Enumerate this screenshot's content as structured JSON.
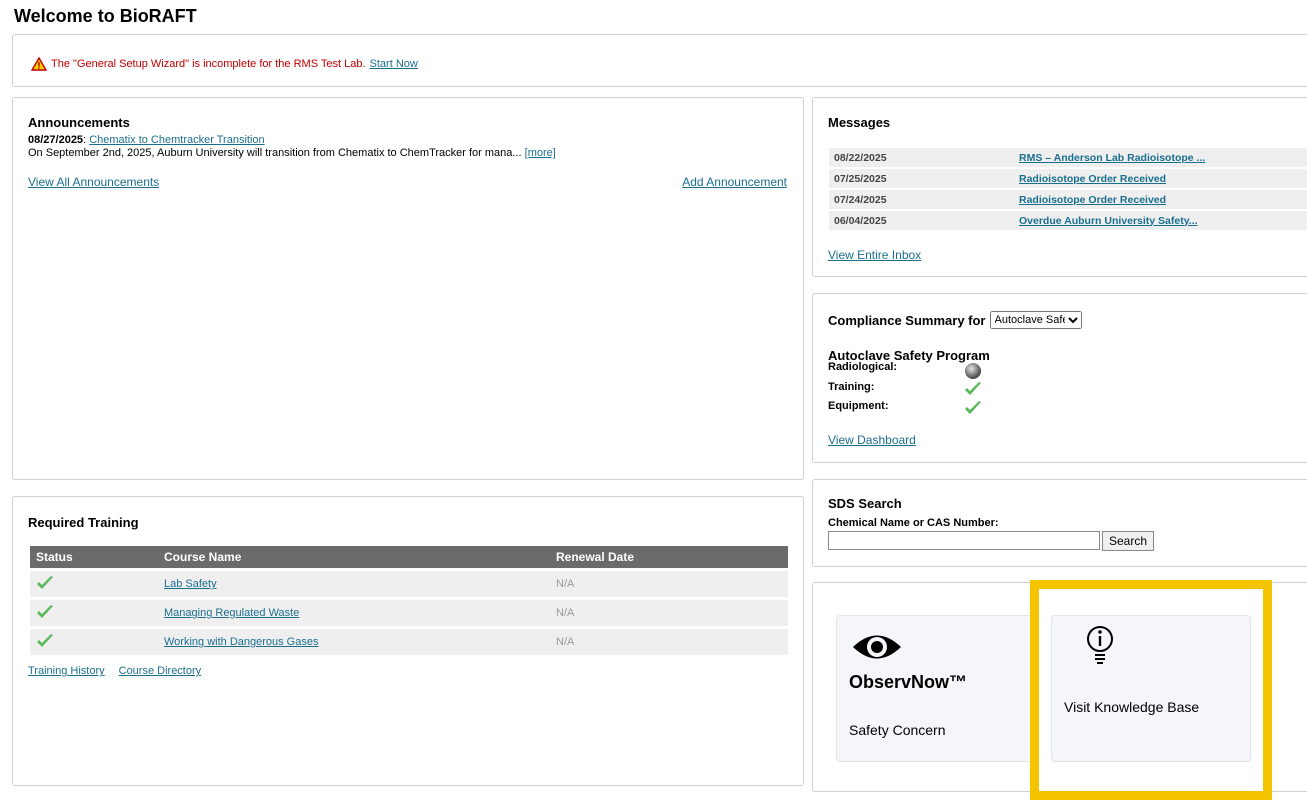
{
  "page": {
    "title": "Welcome to BioRAFT"
  },
  "wizard": {
    "message": "The \"General Setup Wizard\" is incomplete for the RMS Test Lab.",
    "link": "Start Now",
    "icon": "warning-icon"
  },
  "announcements": {
    "title": "Announcements",
    "items": [
      {
        "date": "08/27/2025",
        "title": "Chematix to Chemtracker Transition",
        "summary": "On September 2nd, 2025, Auburn University will transition from Chematix to ChemTracker for mana...",
        "more": "[more]"
      }
    ],
    "view_all": "View All Announcements",
    "add": "Add Announcement"
  },
  "messages": {
    "title": "Messages",
    "rows": [
      {
        "date": "08/22/2025",
        "subject": "RMS – Anderson Lab Radioisotope ..."
      },
      {
        "date": "07/25/2025",
        "subject": "Radioisotope Order Received"
      },
      {
        "date": "07/24/2025",
        "subject": "Radioisotope Order Received"
      },
      {
        "date": "06/04/2025",
        "subject": "Overdue Auburn University Safety..."
      }
    ],
    "view_inbox": "View Entire Inbox"
  },
  "compliance": {
    "title": "Compliance Summary for",
    "select_value": "Autoclave Safety Program",
    "program": "Autoclave Safety Program",
    "rows": [
      {
        "label": "Radiological:",
        "status": "not-applicable"
      },
      {
        "label": "Training:",
        "status": "compliant"
      },
      {
        "label": "Equipment:",
        "status": "compliant"
      }
    ],
    "view_dashboard": "View Dashboard"
  },
  "sds": {
    "title": "SDS Search",
    "label": "Chemical Name or CAS Number:",
    "input_value": "",
    "button": "Search"
  },
  "training": {
    "title": "Required Training",
    "columns": [
      "Status",
      "Course Name",
      "Renewal Date"
    ],
    "rows": [
      {
        "status": "complete",
        "course": "Lab Safety",
        "renewal": "N/A"
      },
      {
        "status": "complete",
        "course": "Managing Regulated Waste",
        "renewal": "N/A"
      },
      {
        "status": "complete",
        "course": "Working with Dangerous Gases",
        "renewal": "N/A"
      }
    ],
    "history": "Training History",
    "directory": "Course Directory"
  },
  "tiles": {
    "observ": {
      "brand": "ObservNow™",
      "caption": "Safety Concern",
      "icon": "eye-icon"
    },
    "kb": {
      "caption": "Visit Knowledge Base",
      "icon": "lightbulb-info-icon"
    }
  },
  "colors": {
    "link": "#1a6f8f",
    "warning_text": "#c00000",
    "check_green": "#5cb85c",
    "highlight": "#f5c400",
    "table_header": "#6b6b6b"
  }
}
